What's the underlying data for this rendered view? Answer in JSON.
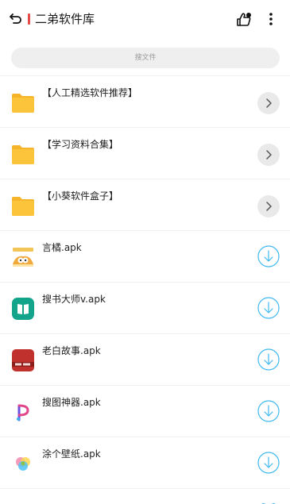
{
  "header": {
    "title": "二弟软件库",
    "accent_color": "#e54b4b"
  },
  "search": {
    "placeholder": "搜文件"
  },
  "folders": [
    {
      "label": "【人工精选软件推荐】"
    },
    {
      "label": "【学习资料合集】"
    },
    {
      "label": "【小葵软件盒子】"
    }
  ],
  "files": [
    {
      "label": "言橘.apk",
      "icon": "yanju-app-icon"
    },
    {
      "label": "搜书大师v.apk",
      "icon": "book-app-icon"
    },
    {
      "label": "老白故事.apk",
      "icon": "laobai-app-icon"
    },
    {
      "label": "搜图神器.apk",
      "icon": "photo-search-app-icon"
    },
    {
      "label": "涂个壁纸.apk",
      "icon": "wallpaper-app-icon"
    }
  ],
  "colors": {
    "folder": "#fcc43b",
    "download": "#3fb8f0",
    "arrow_bg": "#e9e9e9"
  }
}
